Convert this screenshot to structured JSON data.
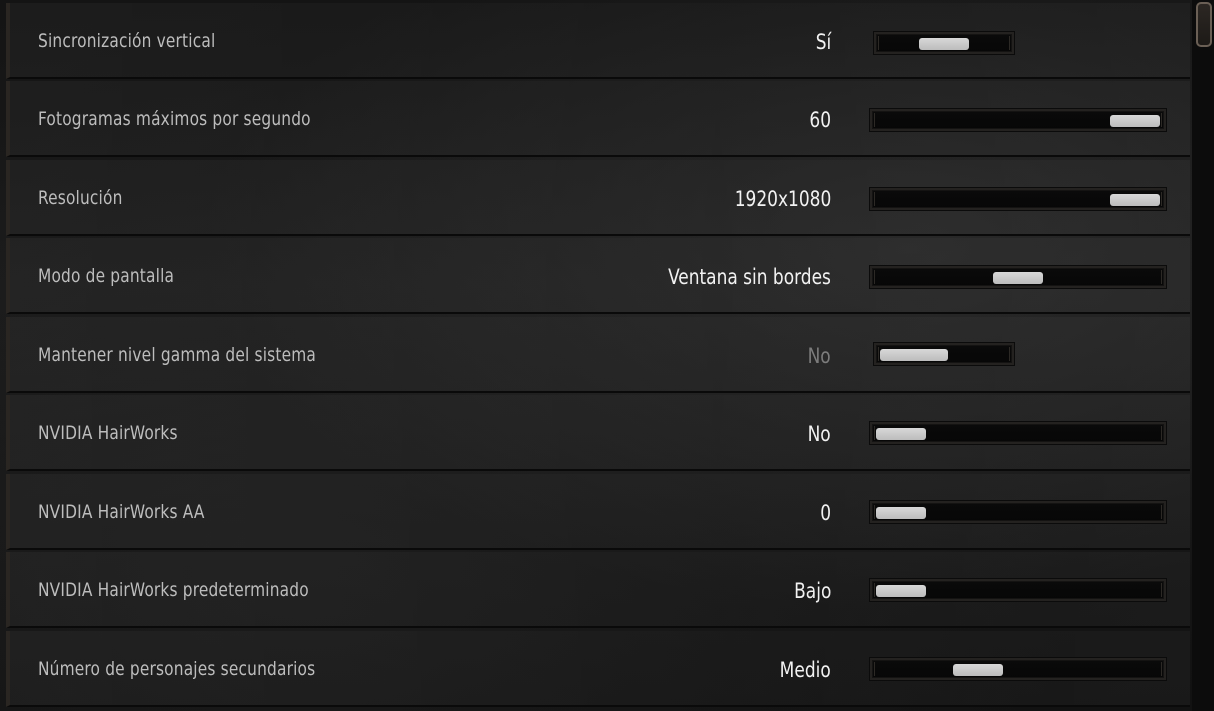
{
  "settings": [
    {
      "label": "Sincronización vertical",
      "value": "Sí",
      "level": 0.5,
      "enabled": true
    },
    {
      "label": "Fotogramas máximos por segundo",
      "value": "60",
      "level": 1.0,
      "enabled": true
    },
    {
      "label": "Resolución",
      "value": "1920x1080",
      "level": 1.0,
      "enabled": true
    },
    {
      "label": "Modo de pantalla",
      "value": "Ventana sin bordes",
      "level": 0.5,
      "enabled": true
    },
    {
      "label": "Mantener nivel gamma del sistema",
      "value": "No",
      "level": 0.0,
      "enabled": false
    },
    {
      "label": "NVIDIA HairWorks",
      "value": "No",
      "level": 0.0,
      "enabled": true
    },
    {
      "label": "NVIDIA HairWorks AA",
      "value": "0",
      "level": 0.0,
      "enabled": true
    },
    {
      "label": "NVIDIA HairWorks predeterminado",
      "value": "Bajo",
      "level": 0.0,
      "enabled": true
    },
    {
      "label": "Número de personajes secundarios",
      "value": "Medio",
      "level": 0.33,
      "enabled": true
    }
  ],
  "colors": {
    "value_enabled": "#f2f2f2",
    "value_disabled": "#7c7c7c",
    "slider_thumb": "#d0d0d0",
    "scrollbar_border": "#6a5f55"
  }
}
